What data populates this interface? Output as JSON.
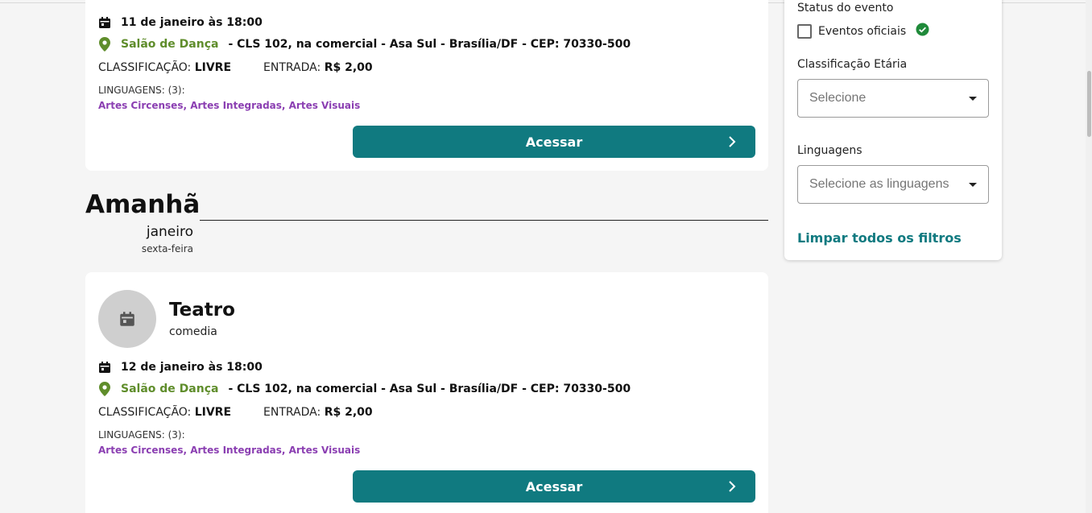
{
  "events_before": [
    {
      "date": "11 de janeiro às 18:00",
      "place": "Salão de Dança",
      "address": "- CLS 102, na comercial - Asa Sul - Brasília/DF - CEP: 70330-500",
      "classificacao_label": "CLASSIFICAÇÃO:",
      "classificacao_value": "LIVRE",
      "entrada_label": "ENTRADA:",
      "entrada_value": "R$ 2,00",
      "linguagens_label": "LINGUAGENS: (3):",
      "linguagens": "Artes Circenses, Artes Integradas, Artes Visuais",
      "button": "Acessar"
    }
  ],
  "date_header": {
    "title": "Amanhã",
    "month": "janeiro",
    "weekday": "sexta-feira"
  },
  "event": {
    "title": "Teatro",
    "subtitle": "comedia",
    "date": "12 de janeiro às 18:00",
    "place": "Salão de Dança",
    "address": "- CLS 102, na comercial - Asa Sul - Brasília/DF - CEP: 70330-500",
    "classificacao_label": "CLASSIFICAÇÃO:",
    "classificacao_value": "LIVRE",
    "entrada_label": "ENTRADA:",
    "entrada_value": "R$ 2,00",
    "linguagens_label": "LINGUAGENS: (3):",
    "linguagens": "Artes Circenses, Artes Integradas, Artes Visuais",
    "button": "Acessar"
  },
  "sidebar": {
    "status_label": "Status do evento",
    "oficiais_label": "Eventos oficiais",
    "classificacao_label": "Classificação Etária",
    "classificacao_placeholder": "Selecione",
    "linguagens_label": "Linguagens",
    "linguagens_placeholder": "Selecione as linguagens",
    "clear_label": "Limpar todos os filtros"
  },
  "colors": {
    "accent": "#107a80",
    "place": "#5f8d2b",
    "linguagens": "#8b3fb2",
    "verified": "#1f8a3a"
  }
}
